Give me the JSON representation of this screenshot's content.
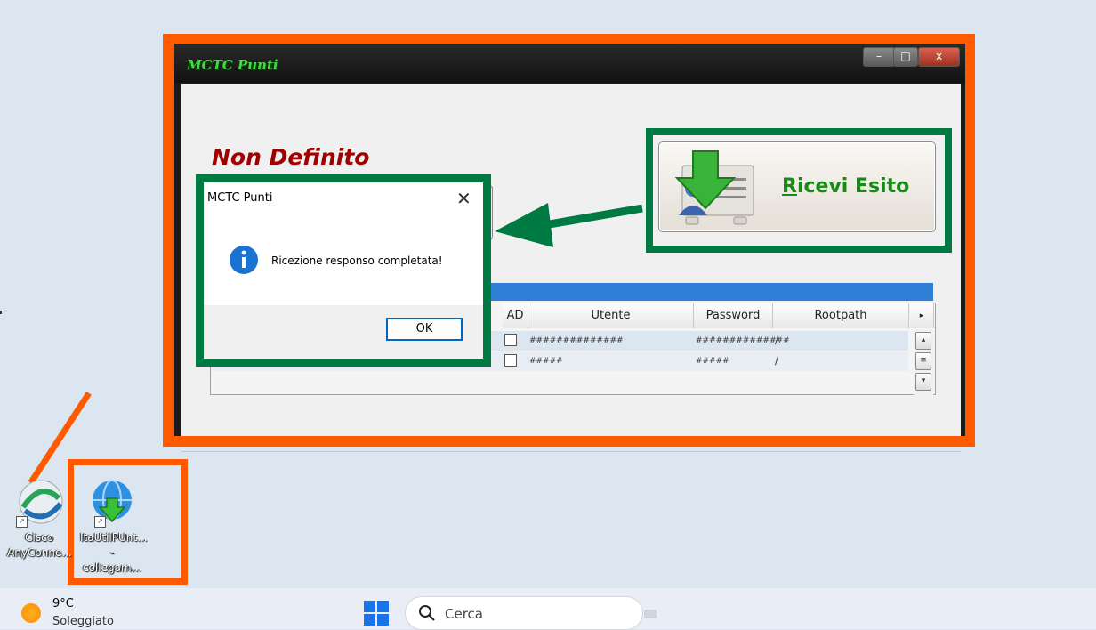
{
  "app": {
    "title": "MCTC Punti",
    "status": "Non Definito",
    "ricevi_button": {
      "accel": "R",
      "rest": "icevi Esito"
    },
    "window_controls": {
      "minimize": "–",
      "maximize": "□",
      "close": "x"
    }
  },
  "grid": {
    "columns": [
      "AD",
      "Utente",
      "Password",
      "Rootpath"
    ],
    "rows": [
      {
        "utente": "##############",
        "password": "##############",
        "rootpath": "/"
      },
      {
        "utente": "#####",
        "password": "#####",
        "rootpath": "/"
      }
    ]
  },
  "dialog": {
    "title": "MCTC Punti",
    "close": "✕",
    "message": "Ricezione responso completata!",
    "ok": "OK"
  },
  "desktop": {
    "icons": [
      {
        "label": "Cisco AnyConne..."
      },
      {
        "label": "ItaUtilPUnt... - collegam..."
      }
    ]
  },
  "taskbar": {
    "temp": "9°C",
    "condition": "Soleggiato",
    "search_placeholder": "Cerca"
  },
  "colors": {
    "highlight_orange": "#ff5a00",
    "highlight_green": "#007a43",
    "status_red": "#a00000",
    "accent_blue": "#0067c0"
  }
}
